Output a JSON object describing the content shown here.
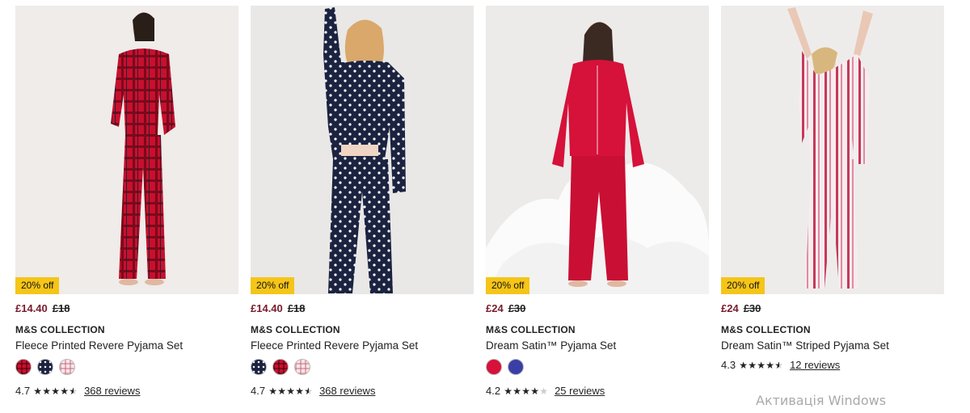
{
  "products": [
    {
      "badge": "20% off",
      "price_now": "£14.40",
      "price_was": "£18",
      "brand": "M&S COLLECTION",
      "title": "Fleece Printed Revere Pyjama Set",
      "swatches": [
        "red check",
        "navy polka dot",
        "pink check"
      ],
      "rating": "4.7",
      "stars": 4.7,
      "reviews": "368 reviews"
    },
    {
      "badge": "20% off",
      "price_now": "£14.40",
      "price_was": "£18",
      "brand": "M&S COLLECTION",
      "title": "Fleece Printed Revere Pyjama Set",
      "swatches": [
        "navy polka dot",
        "red check",
        "pink check"
      ],
      "rating": "4.7",
      "stars": 4.7,
      "reviews": "368 reviews"
    },
    {
      "badge": "20% off",
      "price_now": "£24",
      "price_was": "£30",
      "brand": "M&S COLLECTION",
      "title": "Dream Satin™ Pyjama Set",
      "swatches": [
        "red",
        "blue"
      ],
      "rating": "4.2",
      "stars": 4.2,
      "reviews": "25 reviews"
    },
    {
      "badge": "20% off",
      "price_now": "£24",
      "price_was": "£30",
      "brand": "M&S COLLECTION",
      "title": "Dream Satin™ Striped Pyjama Set",
      "swatches": [],
      "rating": "4.3",
      "stars": 4.3,
      "reviews": "12 reviews"
    }
  ],
  "colors": {
    "badge_bg": "#f5c518",
    "sale_price": "#7a1c2e"
  },
  "watermark": "Активація Windows"
}
